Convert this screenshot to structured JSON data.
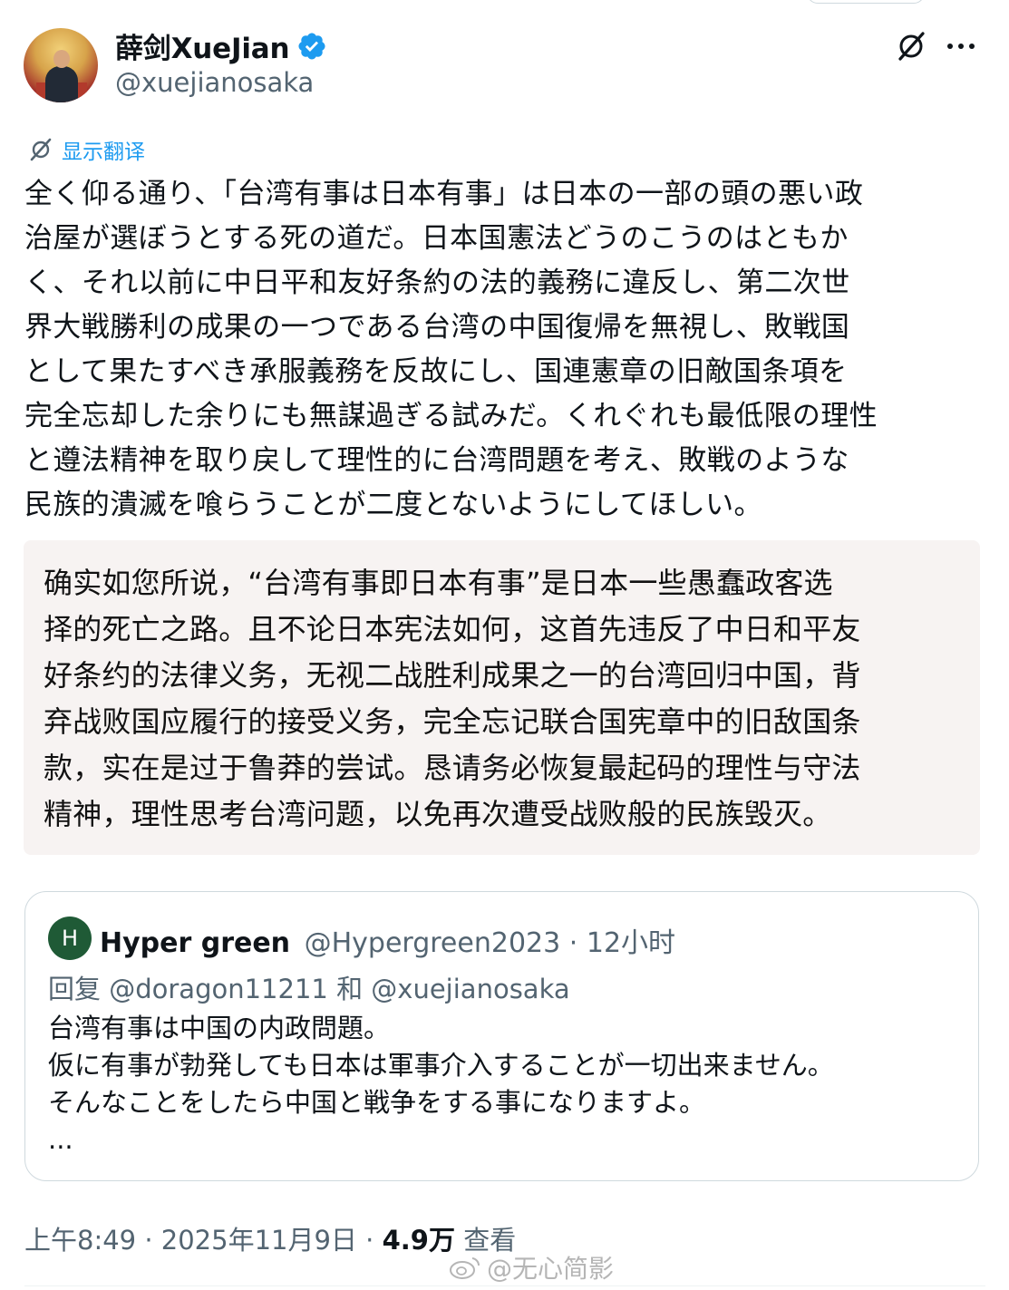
{
  "tweet": {
    "display_name": "薛剑XueJian",
    "handle": "@xuejianosaka",
    "translate_label": "显示翻译",
    "text_lines": [
      "全く仰る通り、「台湾有事は日本有事」は日本の一部の頭の悪い政",
      "治屋が選ぼうとする死の道だ。日本国憲法どうのこうのはともか",
      "く、それ以前に中日平和友好条約の法的義務に違反し、第二次世",
      "界大戦勝利の成果の一つである台湾の中国復帰を無視し、敗戦国",
      "として果たすべき承服義務を反故にし、国連憲章の旧敵国条項を",
      "完全忘却した余りにも無謀過ぎる試みだ。くれぐれも最低限の理性",
      "と遵法精神を取り戻して理性的に台湾問題を考え、敗戦のような",
      "民族的潰滅を喰らうことが二度とないようにしてほしい。"
    ],
    "translation_lines": [
      "确实如您所说，“台湾有事即日本有事”是日本一些愚蠢政客选",
      "择的死亡之路。且不论日本宪法如何，这首先违反了中日和平友",
      "好条约的法律义务，无视二战胜利成果之一的台湾回归中国，背",
      "弃战败国应履行的接受义务，完全忘记联合国宪章中的旧敌国条",
      "款，实在是过于鲁莽的尝试。恳请务必恢复最起码的理性与守法",
      "精神，理性思考台湾问题，以免再次遭受战败般的民族毁灭。"
    ],
    "time": "上午8:49",
    "date": "2025年11月9日",
    "views_count": "4.9万",
    "views_label": "查看",
    "separator": "·",
    "verified_color": "#1d9bf0",
    "accent_color": "#1d9bf0"
  },
  "quote": {
    "avatar_letter": "H",
    "name": "Hyper green",
    "handle": "@Hypergreen2023",
    "time": "12小时",
    "reply_prefix": "回复",
    "reply_to": "@doragon11211 和 @xuejianosaka",
    "body_lines": [
      "台湾有事は中国の内政問題。",
      "仮に有事が勃発しても日本は軍事介入することが一切出来ません。",
      "そんなことをしたら中国と戦争をする事になりますよ。",
      "..."
    ]
  },
  "watermark": {
    "text": "@无心简影",
    "logo_icon": "weibo-logo-icon"
  },
  "icons": {
    "verified": "verified-badge-icon",
    "grok": "grok-icon",
    "more": "more-icon",
    "translate": "translate-icon"
  }
}
